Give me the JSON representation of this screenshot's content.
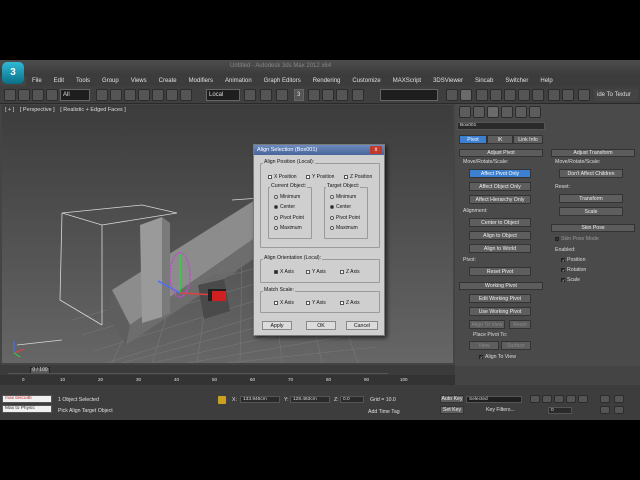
{
  "window": {
    "title": "Untitled - Autodesk 3ds Max 2012 x64",
    "logo_letter": "3"
  },
  "menu": [
    "File",
    "Edit",
    "Tools",
    "Group",
    "Views",
    "Create",
    "Modifiers",
    "Animation",
    "Graph Editors",
    "Rendering",
    "Customize",
    "MAXScript",
    "3DSViewer",
    "Sincab",
    "Switcher",
    "Help"
  ],
  "toolbar": {
    "filter": "All",
    "ref_coord": "Local",
    "snap_num": "3",
    "named_sel": ""
  },
  "viewport": {
    "label_a": "[ + ]",
    "label_b": "[ Perspective ]",
    "label_c": "[ Realistic + Edged Faces ]"
  },
  "dialog": {
    "title": "Align Selection (Box001)",
    "close": "x",
    "align_position_label": "Align Position (Local):",
    "pos_axes": [
      "X Position",
      "Y Position",
      "Z Position"
    ],
    "current_label": "Current Object:",
    "target_label": "Target Object:",
    "options": [
      "Minimum",
      "Center",
      "Pivot Point",
      "Maximum"
    ],
    "current_selected": "Center",
    "target_selected": "Center",
    "orientation_label": "Align Orientation (Local):",
    "orient_axes": [
      "X Axis",
      "Y Axis",
      "Z Axis"
    ],
    "scale_label": "Match Scale:",
    "scale_axes": [
      "X Axis",
      "Y Axis",
      "Z Axis"
    ],
    "apply": "Apply",
    "ok": "OK",
    "cancel": "Cancel"
  },
  "panel": {
    "object_name": "Box001",
    "hier_tabs": [
      "Pivot",
      "IK",
      "Link Info"
    ],
    "adjust_pivot": "Adjust Pivot",
    "move_rotate_scale": "Move/Rotate/Scale:",
    "affect_pivot_only": "Affect Pivot Only",
    "affect_object_only": "Affect Object Only",
    "affect_hierarchy_only": "Affect Hierarchy Only",
    "alignment": "Alignment:",
    "center_to_object": "Center to Object",
    "align_to_object": "Align to Object",
    "align_to_world": "Align to World",
    "pivot": "Pivot:",
    "reset_pivot": "Reset Pivot",
    "working_pivot": "Working Pivot",
    "edit_working_pivot": "Edit Working Pivot",
    "use_working_pivot": "Use Working Pivot",
    "align_to_view": "Align To View",
    "reset": "Reset",
    "place_pivot_to": "Place Pivot To:",
    "view": "View",
    "surface": "Surface",
    "align_to_view2": "Align To View",
    "adjust_transform": "Adjust Transform",
    "move_rotate_scale2": "Move/Rotate/Scale:",
    "dont_affect_children": "Don't Affect Children",
    "reset_label": "Reset:",
    "transform": "Transform",
    "scale": "Scale",
    "skin_pose": "Skin Pose",
    "skin_pose_mode": "Skin Pose Mode",
    "enabled": "Enabled:",
    "position": "Position",
    "rotation": "Rotation",
    "scale2": "Scale",
    "extra_tab": "ide To Textur"
  },
  "timeline": {
    "frame": "0 / 100",
    "ticks": [
      "0",
      "10",
      "20",
      "30",
      "40",
      "50",
      "60",
      "70",
      "80",
      "90",
      "100"
    ]
  },
  "status": {
    "maxscript_a": "max biscuitb",
    "maxscript_b": "Max to Physic",
    "selected": "1 Object Selected",
    "prompt": "Pick Align Target Object",
    "x_label": "X:",
    "x_val": "133.946cm",
    "y_label": "Y:",
    "y_val": "128.463cm",
    "z_label": "Z:",
    "z_val": "0.0",
    "grid": "Grid = 10.0",
    "add_time_tag": "Add Time Tag",
    "auto_key": "Auto Key",
    "set_key": "Set Key",
    "key_mode": "Selected",
    "key_filters": "Key Filters...",
    "frame_num": "0"
  }
}
